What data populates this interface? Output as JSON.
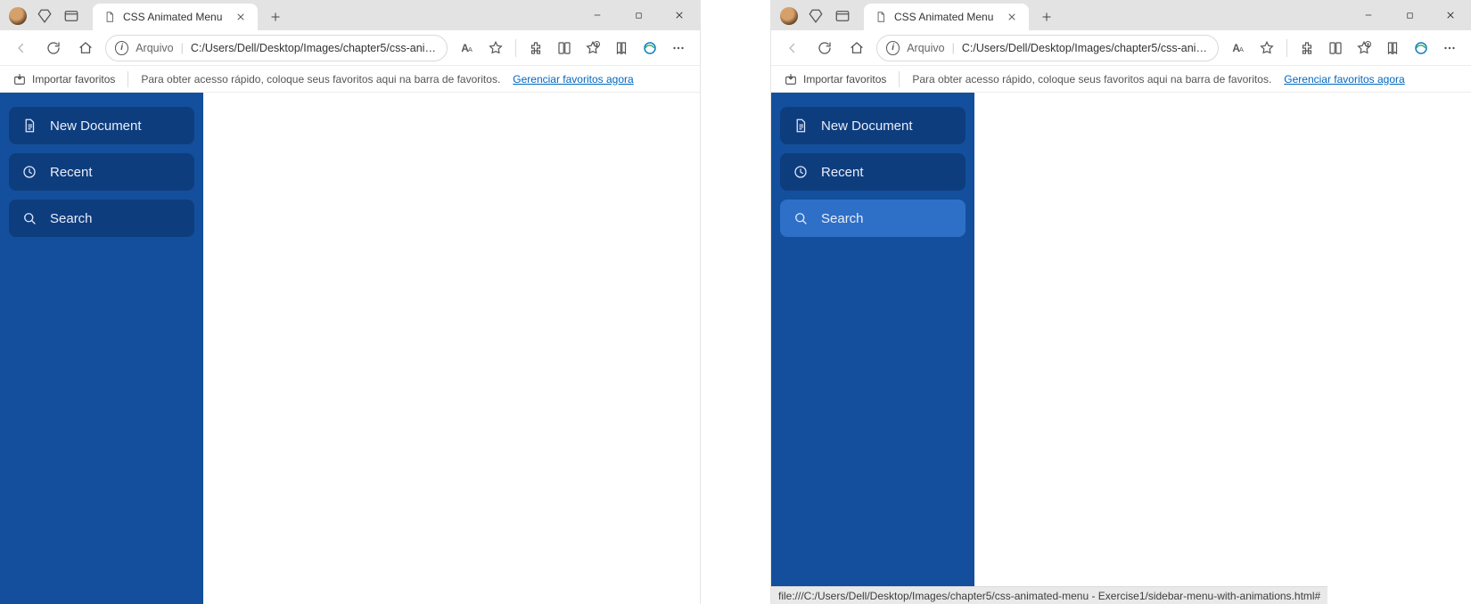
{
  "colors": {
    "sidebar_bg": "#134f9c",
    "menu_bg": "#0e3d7e",
    "menu_hover_bg": "#2e6fc7",
    "link": "#0067c0"
  },
  "left": {
    "tab_title": "CSS Animated Menu",
    "address_scheme": "Arquivo",
    "address_path": "C:/Users/Dell/Desktop/Images/chapter5/css-animat...",
    "bookbar_import": "Importar favoritos",
    "bookbar_hint": "Para obter acesso rápido, coloque seus favoritos aqui na barra de favoritos.",
    "bookbar_link": "Gerenciar favoritos agora",
    "menu": [
      {
        "label": "New Document",
        "icon": "doc"
      },
      {
        "label": "Recent",
        "icon": "clock"
      },
      {
        "label": "Search",
        "icon": "search"
      }
    ],
    "hover_index": -1
  },
  "right": {
    "tab_title": "CSS Animated Menu",
    "address_scheme": "Arquivo",
    "address_path": "C:/Users/Dell/Desktop/Images/chapter5/css-animat...",
    "bookbar_import": "Importar favoritos",
    "bookbar_hint": "Para obter acesso rápido, coloque seus favoritos aqui na barra de favoritos.",
    "bookbar_link": "Gerenciar favoritos agora",
    "menu": [
      {
        "label": "New Document",
        "icon": "doc"
      },
      {
        "label": "Recent",
        "icon": "clock"
      },
      {
        "label": "Search",
        "icon": "search"
      }
    ],
    "hover_index": 2,
    "status_text": "file:///C:/Users/Dell/Desktop/Images/chapter5/css-animated-menu - Exercise1/sidebar-menu-with-animations.html#"
  }
}
